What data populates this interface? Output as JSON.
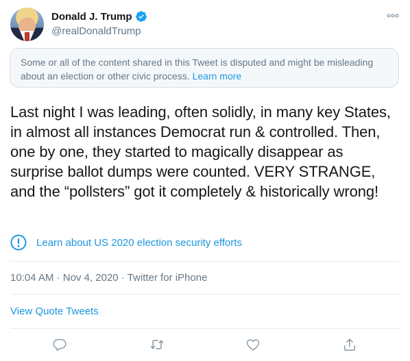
{
  "user": {
    "name": "Donald J. Trump",
    "handle": "@realDonaldTrump",
    "verified": true
  },
  "notice": {
    "text": "Some or all of the content shared in this Tweet is disputed and might be misleading about an election or other civic process.",
    "link": "Learn more"
  },
  "tweet": {
    "text": "Last night I was leading, often solidly, in many key States, in almost all instances Democrat run & controlled. Then, one by one, they started to magically disappear as surprise ballot dumps were counted. VERY STRANGE, and the “pollsters” got it completely & historically wrong!"
  },
  "misinfo_link": "Learn about US 2020 election security efforts",
  "meta": {
    "time": "10:04 AM",
    "dot": "·",
    "date": "Nov 4, 2020",
    "source": "Twitter for iPhone"
  },
  "quote_tweets": "View Quote Tweets",
  "icons": {
    "verified": "verified-badge-icon",
    "more": "more-icon",
    "info": "info-icon",
    "reply": "reply-icon",
    "retweet": "retweet-icon",
    "like": "like-icon",
    "share": "share-icon"
  },
  "colors": {
    "link": "#1b95e0",
    "secondary": "#657786",
    "icon": "#8899a6"
  }
}
